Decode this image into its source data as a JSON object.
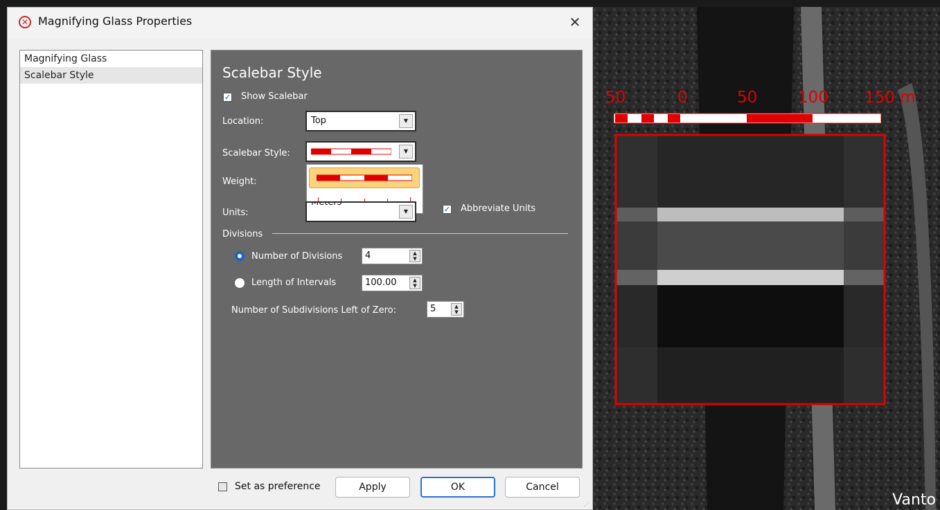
{
  "dialog": {
    "title": "Magnifying Glass Properties",
    "close_label": "✕"
  },
  "nav": {
    "items": [
      {
        "label": "Magnifying Glass",
        "selected": false
      },
      {
        "label": "Scalebar Style",
        "selected": true
      }
    ]
  },
  "panel": {
    "title": "Scalebar Style",
    "show_scalebar": {
      "label": "Show Scalebar",
      "checked": true
    },
    "location": {
      "label": "Location:",
      "value": "Top"
    },
    "scalebar_style": {
      "label": "Scalebar Style:",
      "dropdown_open": true,
      "options": [
        "alternating-red-white-bar",
        "red-tick-line"
      ],
      "highlighted": 0
    },
    "weight": {
      "label": "Weight:"
    },
    "units": {
      "label": "Units:",
      "value": "Meters"
    },
    "abbreviate_units": {
      "label": "Abbreviate Units",
      "checked": true
    },
    "divisions": {
      "group_label": "Divisions",
      "number_of_divisions": {
        "label": "Number of Divisions",
        "value": "4",
        "selected": true
      },
      "length_of_intervals": {
        "label": "Length of Intervals",
        "value": "100.00",
        "selected": false
      },
      "subdivisions_left": {
        "label": "Number of Subdivisions Left of Zero:",
        "value": "5"
      }
    }
  },
  "footer": {
    "set_as_preference": {
      "label": "Set as preference",
      "checked": false
    },
    "apply_label": "Apply",
    "ok_label": "OK",
    "cancel_label": "Cancel"
  },
  "map": {
    "scale_labels": [
      "50",
      "0",
      "50",
      "100",
      "150 m"
    ],
    "accent_color": "#e00000",
    "watermark": "Vanto"
  }
}
